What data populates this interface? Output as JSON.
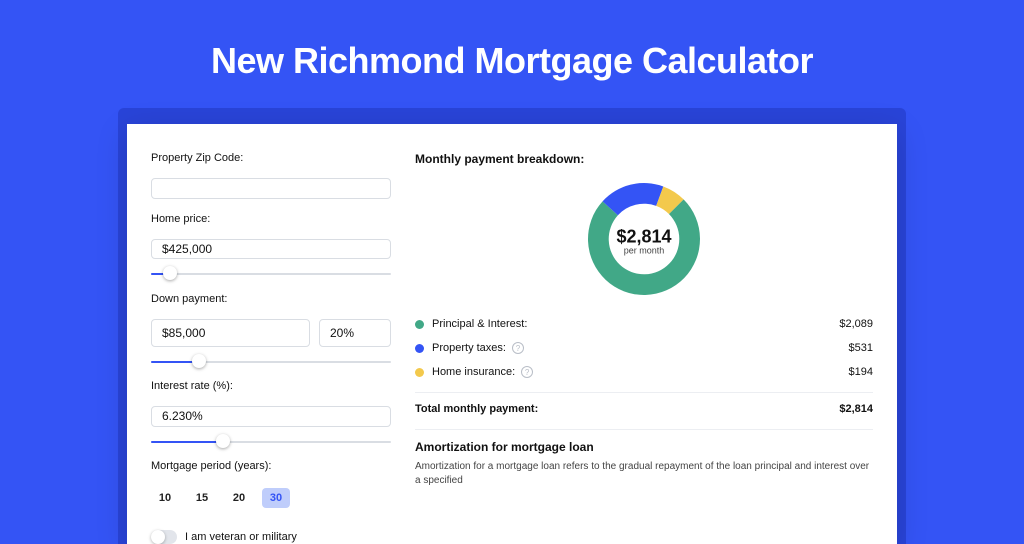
{
  "title": "New Richmond Mortgage Calculator",
  "colors": {
    "principal": "#41a887",
    "taxes": "#3454f5",
    "insurance": "#f3c94c"
  },
  "inputs": {
    "zip_label": "Property Zip Code:",
    "zip_value": "",
    "price_label": "Home price:",
    "price_value": "$425,000",
    "price_slider_pos_pct": 8,
    "down_label": "Down payment:",
    "down_value": "$85,000",
    "down_pct_value": "20%",
    "down_slider_pos_pct": 20,
    "rate_label": "Interest rate (%):",
    "rate_value": "6.230%",
    "rate_slider_pos_pct": 30,
    "period_label": "Mortgage period (years):",
    "periods": [
      "10",
      "15",
      "20",
      "30"
    ],
    "period_active_index": 3,
    "veteran_label": "I am veteran or military"
  },
  "breakdown": {
    "heading": "Monthly payment breakdown:",
    "center_value": "$2,814",
    "center_sub": "per month",
    "rows": [
      {
        "label": "Principal & Interest:",
        "value": "$2,089",
        "color": "#41a887",
        "info": false
      },
      {
        "label": "Property taxes:",
        "value": "$531",
        "color": "#3454f5",
        "info": true
      },
      {
        "label": "Home insurance:",
        "value": "$194",
        "color": "#f3c94c",
        "info": true
      }
    ],
    "total_label": "Total monthly payment:",
    "total_value": "$2,814"
  },
  "amortization": {
    "heading": "Amortization for mortgage loan",
    "body": "Amortization for a mortgage loan refers to the gradual repayment of the loan principal and interest over a specified"
  },
  "chart_data": {
    "type": "pie",
    "title": "Monthly payment breakdown",
    "series": [
      {
        "name": "Principal & Interest",
        "value": 2089,
        "color": "#41a887"
      },
      {
        "name": "Property taxes",
        "value": 531,
        "color": "#3454f5"
      },
      {
        "name": "Home insurance",
        "value": 194,
        "color": "#f3c94c"
      }
    ],
    "total": 2814,
    "donut_inner_ratio": 0.63,
    "start_angle_deg": -45
  }
}
